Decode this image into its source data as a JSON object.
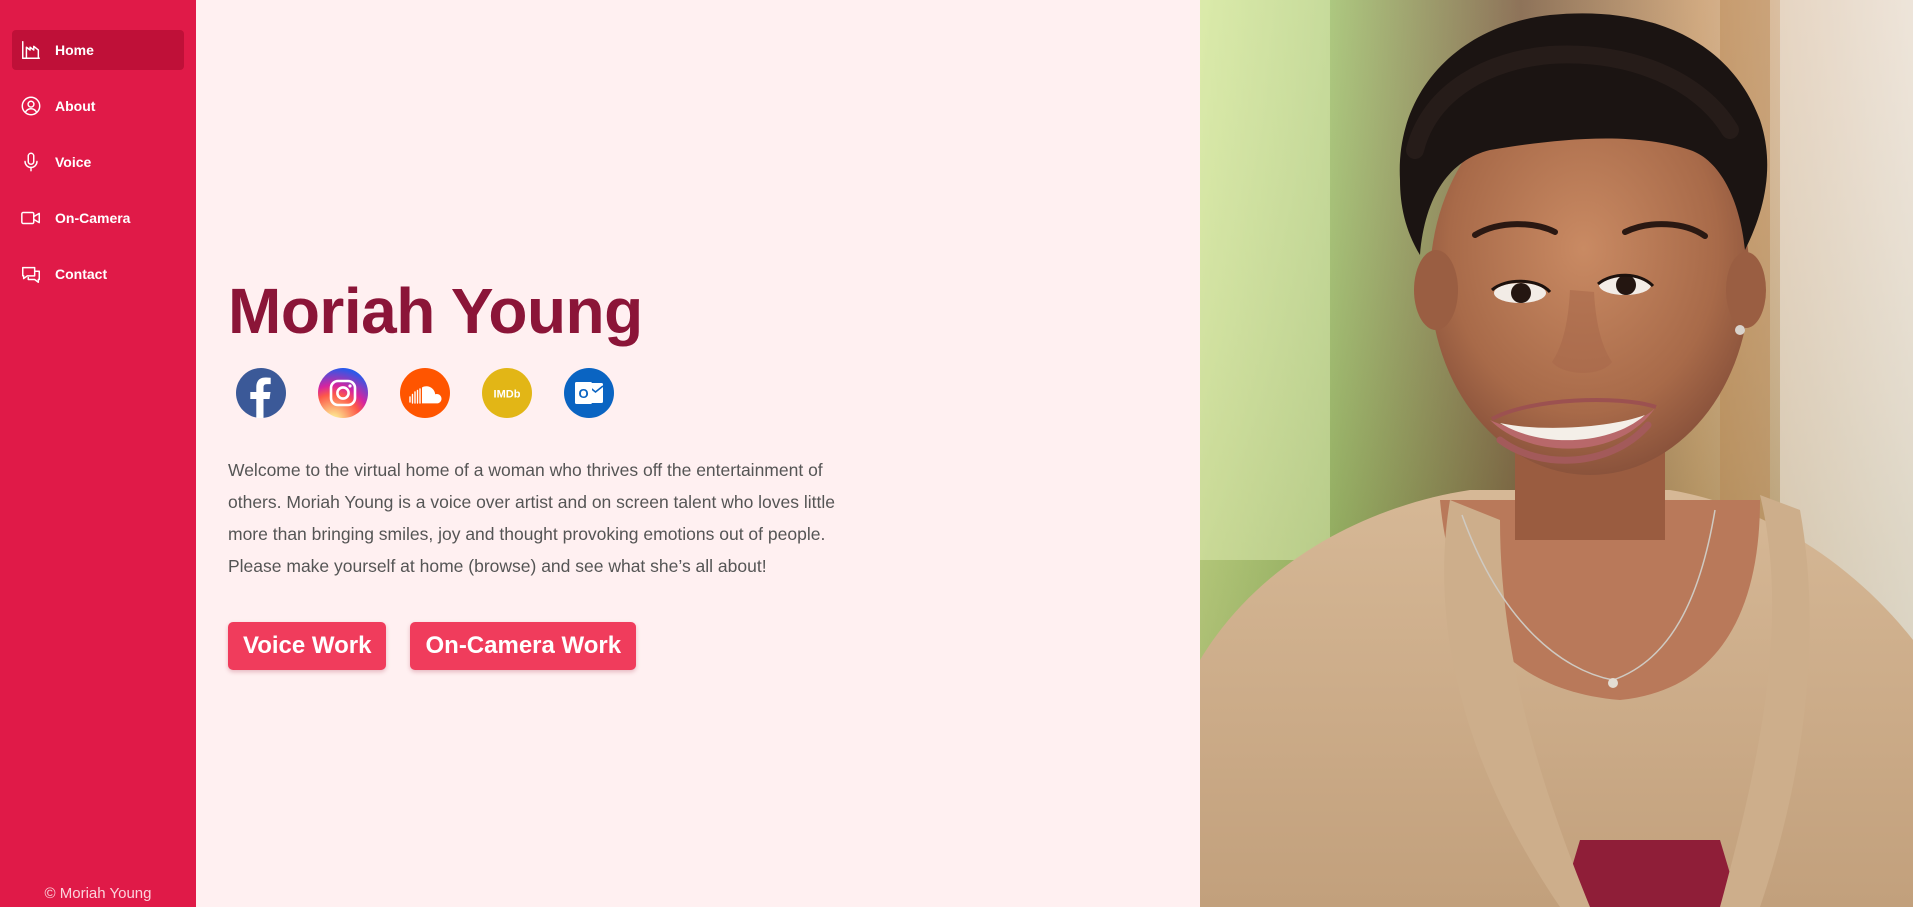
{
  "sidebar": {
    "items": [
      {
        "label": "Home",
        "icon": "home-icon",
        "active": true
      },
      {
        "label": "About",
        "icon": "user-icon",
        "active": false
      },
      {
        "label": "Voice",
        "icon": "microphone-icon",
        "active": false
      },
      {
        "label": "On-Camera",
        "icon": "video-camera-icon",
        "active": false
      },
      {
        "label": "Contact",
        "icon": "chat-icon",
        "active": false
      }
    ],
    "copyright": "© Moriah Young"
  },
  "main": {
    "title": "Moriah Young",
    "socials": [
      {
        "name": "facebook",
        "icon": "facebook-icon",
        "color": "#3b5998"
      },
      {
        "name": "instagram",
        "icon": "instagram-icon",
        "color": "#d6249f"
      },
      {
        "name": "soundcloud",
        "icon": "soundcloud-icon",
        "color": "#ff5500"
      },
      {
        "name": "imdb",
        "icon": "imdb-icon",
        "color": "#e2b616",
        "label": "IMDb"
      },
      {
        "name": "outlook",
        "icon": "outlook-icon",
        "color": "#0a64c2",
        "label": "O"
      }
    ],
    "intro": "Welcome to the virtual home of a woman who thrives off the entertainment of others. Moriah Young is a voice over artist and on screen talent who loves little more than bringing smiles, joy and thought provoking emotions out of people. Please make yourself at home (browse) and see what she’s all about!",
    "buttons": {
      "voice": "Voice Work",
      "camera": "On-Camera Work"
    }
  },
  "colors": {
    "sidebar": "#e01a48",
    "sidebar_active": "#bf1038",
    "title": "#8b1538",
    "button": "#f03c5c",
    "background": "#fff0f1"
  }
}
